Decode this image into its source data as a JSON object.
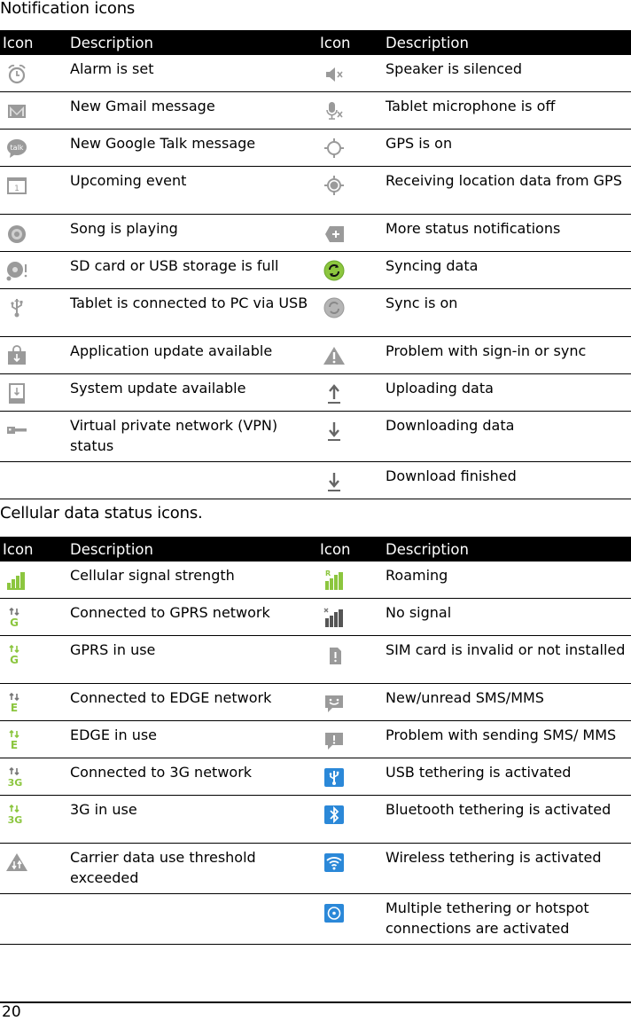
{
  "sections": [
    {
      "title": "Notification icons",
      "headers": [
        "Icon",
        "Description",
        "Icon",
        "Description"
      ],
      "rows": [
        {
          "left": {
            "icon": "alarm-icon",
            "text": "Alarm is set"
          },
          "right": {
            "icon": "speaker-muted-icon",
            "text": "Speaker is silenced"
          }
        },
        {
          "left": {
            "icon": "gmail-icon",
            "text": "New Gmail message"
          },
          "right": {
            "icon": "microphone-off-icon",
            "text": "Tablet microphone is off"
          }
        },
        {
          "left": {
            "icon": "talk-icon",
            "text": "New Google Talk message"
          },
          "right": {
            "icon": "gps-on-icon",
            "text": "GPS is on"
          }
        },
        {
          "left": {
            "icon": "calendar-icon",
            "text": "Upcoming event"
          },
          "right": {
            "icon": "gps-receiving-icon",
            "text": "Receiving location data from GPS"
          }
        },
        {
          "left": {
            "icon": "music-disc-icon",
            "text": "Song is playing"
          },
          "right": {
            "icon": "more-notifications-icon",
            "text": "More status notifications"
          }
        },
        {
          "left": {
            "icon": "storage-full-icon",
            "text": "SD card or USB storage is full"
          },
          "right": {
            "icon": "syncing-icon",
            "text": "Syncing data"
          }
        },
        {
          "left": {
            "icon": "usb-icon",
            "text": "Tablet is connected to PC via USB"
          },
          "right": {
            "icon": "sync-on-icon",
            "text": "Sync is on"
          }
        },
        {
          "left": {
            "icon": "app-update-icon",
            "text": "Application update available"
          },
          "right": {
            "icon": "warning-icon",
            "text": "Problem with sign-in or sync"
          }
        },
        {
          "left": {
            "icon": "system-update-icon",
            "text": "System update available"
          },
          "right": {
            "icon": "upload-icon",
            "text": "Uploading data"
          }
        },
        {
          "left": {
            "icon": "vpn-key-icon",
            "text": "Virtual private network (VPN) status"
          },
          "right": {
            "icon": "download-icon",
            "text": "Downloading data"
          }
        },
        {
          "left": {
            "icon": "",
            "text": ""
          },
          "right": {
            "icon": "download-finished-icon",
            "text": "Download finished"
          }
        }
      ]
    },
    {
      "title": "Cellular data status icons.",
      "headers": [
        "Icon",
        "Description",
        "Icon",
        "Description"
      ],
      "rows": [
        {
          "left": {
            "icon": "signal-strength-icon",
            "text": "Cellular signal strength"
          },
          "right": {
            "icon": "roaming-icon",
            "text": "Roaming"
          }
        },
        {
          "left": {
            "icon": "gprs-connected-icon",
            "text": "Connected to GPRS network"
          },
          "right": {
            "icon": "no-signal-icon",
            "text": "No signal"
          }
        },
        {
          "left": {
            "icon": "gprs-in-use-icon",
            "text": "GPRS in use"
          },
          "right": {
            "icon": "sim-invalid-icon",
            "text": "SIM card is invalid or not installed"
          }
        },
        {
          "left": {
            "icon": "edge-connected-icon",
            "text": "Connected to EDGE network"
          },
          "right": {
            "icon": "sms-unread-icon",
            "text": "New/unread SMS/MMS"
          }
        },
        {
          "left": {
            "icon": "edge-in-use-icon",
            "text": "EDGE in use"
          },
          "right": {
            "icon": "sms-error-icon",
            "text": "Problem with sending SMS/ MMS"
          }
        },
        {
          "left": {
            "icon": "3g-connected-icon",
            "text": "Connected to 3G network"
          },
          "right": {
            "icon": "usb-tethering-icon",
            "text": "USB tethering is activated"
          }
        },
        {
          "left": {
            "icon": "3g-in-use-icon",
            "text": "3G in use"
          },
          "right": {
            "icon": "bluetooth-tethering-icon",
            "text": "Bluetooth tethering is activated"
          }
        },
        {
          "left": {
            "icon": "data-threshold-icon",
            "text": "Carrier data use threshold exceeded"
          },
          "right": {
            "icon": "wifi-tethering-icon",
            "text": "Wireless tethering is activated"
          }
        },
        {
          "left": {
            "icon": "",
            "text": ""
          },
          "right": {
            "icon": "multi-tethering-icon",
            "text": "Multiple tethering or hotspot connections are activated"
          }
        }
      ]
    }
  ],
  "colors": {
    "icon_gray": "#9a9a9a",
    "icon_green": "#8cc63f",
    "icon_blue": "#2b88d8",
    "header_bg": "#000000",
    "header_text": "#ffffff"
  },
  "footer": {
    "page_number": "20"
  }
}
